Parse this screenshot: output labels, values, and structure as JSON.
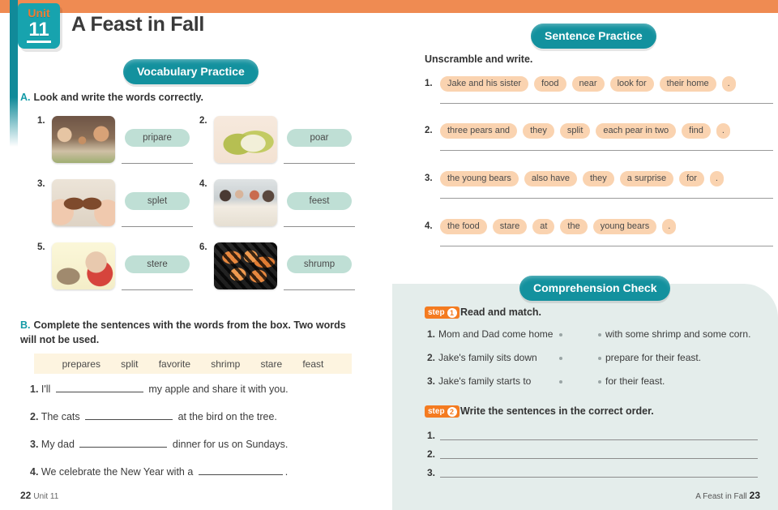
{
  "header": {
    "unit_word": "Unit",
    "unit_number": "11",
    "title": "A Feast in Fall"
  },
  "sections": {
    "vocabulary_pill": "Vocabulary Practice",
    "sentence_pill": "Sentence Practice",
    "comprehension_pill": "Comprehension Check"
  },
  "colors": {
    "teal": "#13919e",
    "orange": "#ef8b52",
    "mint_chip": "#bfdfd5",
    "peach_chip": "#fad3b0",
    "cream_box": "#fdf4e0",
    "panel_bg": "#e4edeb"
  },
  "exercise_a": {
    "letter": "A.",
    "instruction": "Look and write the words correctly.",
    "items": [
      {
        "num": "1.",
        "word": "pripare",
        "image": "family-cooking-photo"
      },
      {
        "num": "2.",
        "word": "poar",
        "image": "pear-fruit-photo"
      },
      {
        "num": "3.",
        "word": "splet",
        "image": "hands-splitting-cookie-photo"
      },
      {
        "num": "4.",
        "word": "feest",
        "image": "family-dinner-table-photo"
      },
      {
        "num": "5.",
        "word": "stere",
        "image": "baby-staring-at-kitten-photo"
      },
      {
        "num": "6.",
        "word": "shrump",
        "image": "grilled-shrimp-photo"
      }
    ]
  },
  "exercise_b": {
    "letter": "B.",
    "instruction": "Complete the sentences with the words from the box. Two words will not be used.",
    "word_box": [
      "prepares",
      "split",
      "favorite",
      "shrimp",
      "stare",
      "feast"
    ],
    "sentences": [
      {
        "num": "1.",
        "before": "I'll",
        "after": "my apple and share it with you."
      },
      {
        "num": "2.",
        "before": "The cats",
        "after": "at the bird on the tree."
      },
      {
        "num": "3.",
        "before": "My dad",
        "after": "dinner for us on Sundays."
      },
      {
        "num": "4.",
        "before": "We celebrate the New Year with a",
        "after": "."
      }
    ]
  },
  "unscramble": {
    "instruction": "Unscramble and write.",
    "items": [
      {
        "num": "1.",
        "chips": [
          "Jake and his sister",
          "food",
          "near",
          "look for",
          "their home",
          "."
        ]
      },
      {
        "num": "2.",
        "chips": [
          "three pears and",
          "they",
          "split",
          "each pear in two",
          "find",
          "."
        ]
      },
      {
        "num": "3.",
        "chips": [
          "the young bears",
          "also have",
          "they",
          "a surprise",
          "for",
          "."
        ]
      },
      {
        "num": "4.",
        "chips": [
          "the food",
          "stare",
          "at",
          "the",
          "young bears",
          "."
        ]
      }
    ]
  },
  "comprehension": {
    "step1": {
      "step_word": "step",
      "step_num": "1",
      "title": "Read and match."
    },
    "match_left": [
      {
        "num": "1.",
        "text": "Mom and Dad come home"
      },
      {
        "num": "2.",
        "text": "Jake's family sits down"
      },
      {
        "num": "3.",
        "text": "Jake's family starts to"
      }
    ],
    "match_right": [
      "with some shrimp and some corn.",
      "prepare for their feast.",
      "for their feast."
    ],
    "step2": {
      "step_word": "step",
      "step_num": "2",
      "title": "Write the sentences in the correct order."
    },
    "order_nums": [
      "1.",
      "2.",
      "3."
    ]
  },
  "footer": {
    "left_page": "22",
    "left_label": "Unit 11",
    "right_label": "A Feast in Fall",
    "right_page": "23"
  }
}
